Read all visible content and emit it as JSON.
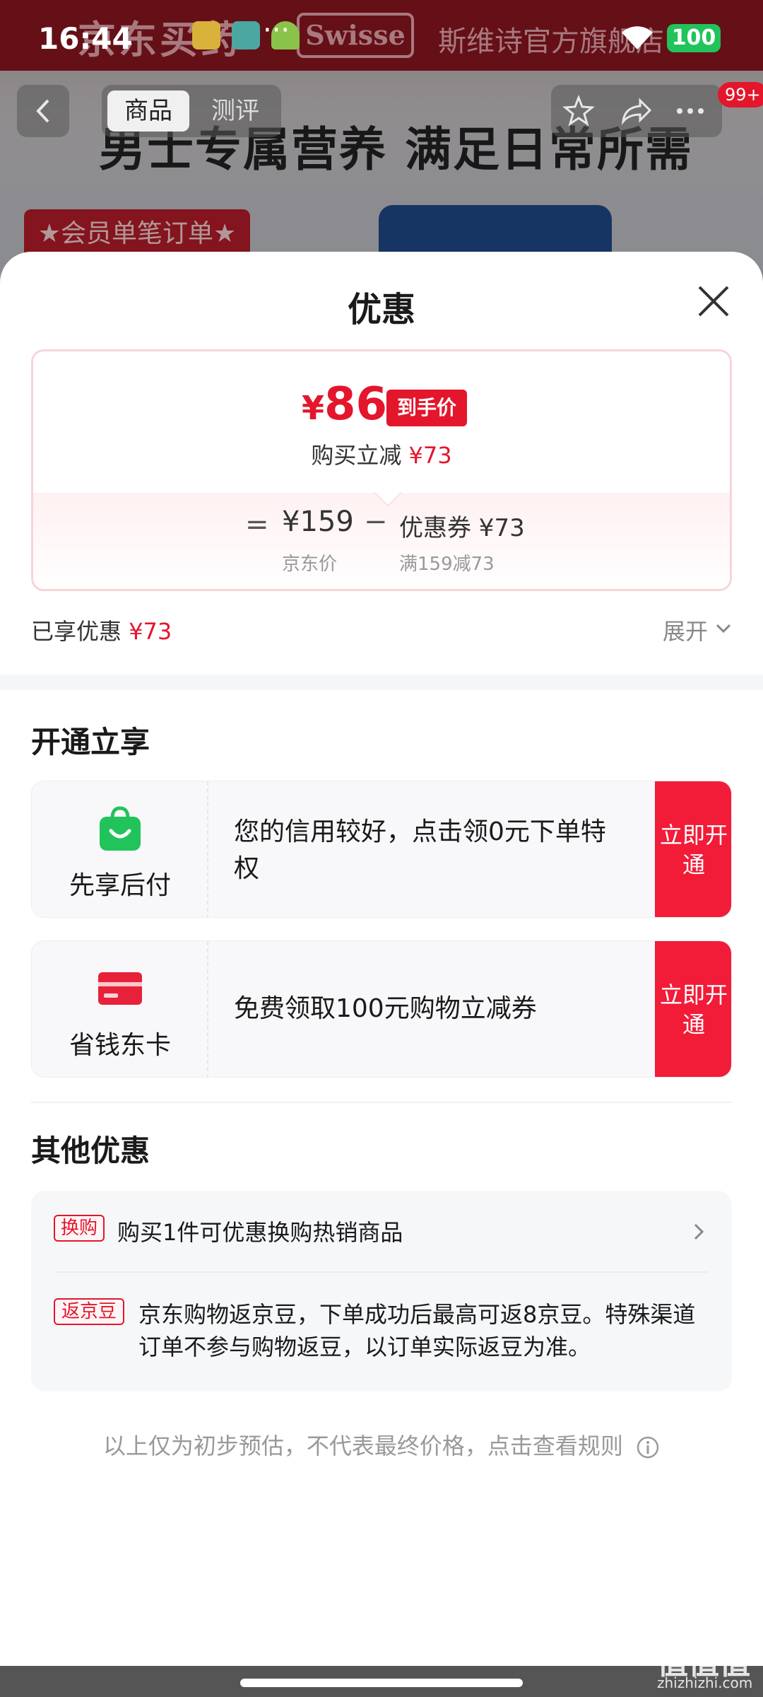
{
  "status_bar": {
    "time": "16:44",
    "dots": "···",
    "battery": "100"
  },
  "background": {
    "logo_text": "京东买药",
    "brand": "Swisse",
    "store_name": "斯维诗官方旗舰店",
    "headline": "男士专属营养 满足日常所需",
    "member_tag": "★会员单笔订单★"
  },
  "nav": {
    "tabs": [
      {
        "label": "商品"
      },
      {
        "label": "测评"
      }
    ],
    "badge": "99+"
  },
  "sheet": {
    "title": "优惠",
    "price_card": {
      "currency": "¥",
      "final_price": "86",
      "final_tag": "到手价",
      "reduce_label": "购买立减",
      "reduce_amount": "¥73",
      "equals": "=",
      "jd_price": "¥159",
      "jd_price_label": "京东价",
      "minus": "−",
      "coupon_text": "优惠券 ¥73",
      "coupon_condition": "满159减73"
    },
    "enjoyed_label": "已享优惠",
    "enjoyed_amount": "¥73",
    "expand_label": "展开"
  },
  "open_section": {
    "title": "开通立享",
    "cards": [
      {
        "name": "先享后付",
        "desc": "您的信用较好，点击领0元下单特权",
        "button": "立即开通"
      },
      {
        "name": "省钱东卡",
        "desc": "免费领取100元购物立减券",
        "button": "立即开通"
      }
    ]
  },
  "other_section": {
    "title": "其他优惠",
    "items": [
      {
        "tag": "换购",
        "text": "购买1件可优惠换购热销商品"
      },
      {
        "tag": "返京豆",
        "text": "京东购物返京豆，下单成功后最高可返8京豆。特殊渠道订单不参与购物返豆，以订单实际返豆为准。"
      }
    ]
  },
  "footnote": "以上仅为初步预估，不代表最终价格，点击查看规则",
  "watermark": {
    "text": "值值值",
    "domain": "zhizhizhi.com"
  },
  "colors": {
    "accent_red": "#e3162c",
    "button_red": "#f21c38",
    "bnpl_green": "#21c35a"
  }
}
